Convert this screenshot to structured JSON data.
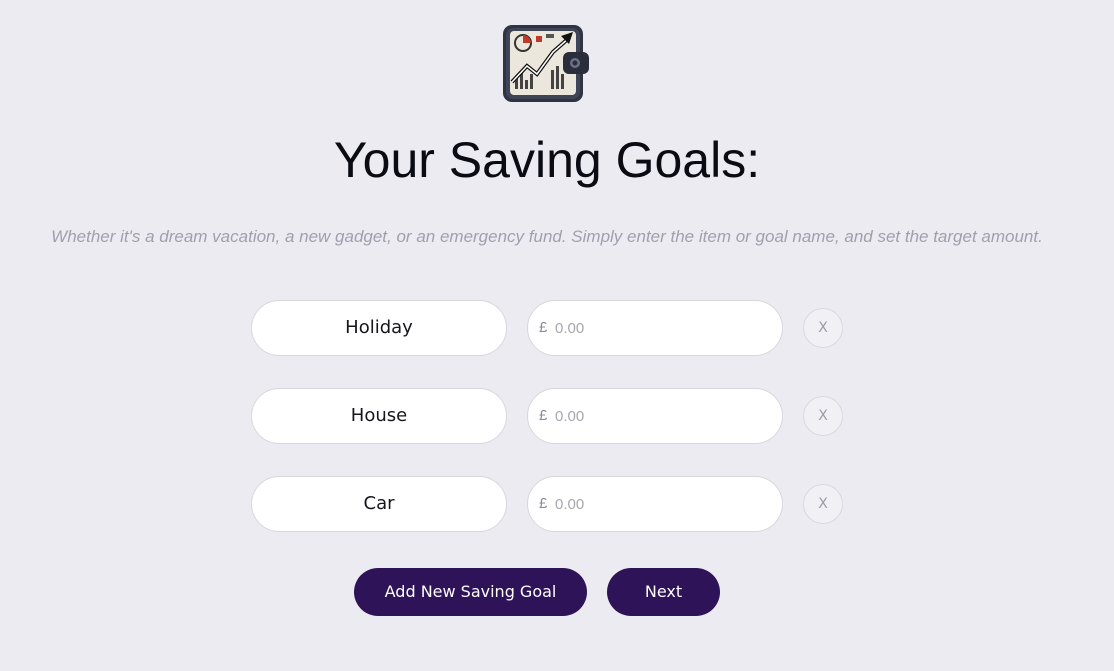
{
  "header": {
    "logo_icon": "wallet-growth-chart-icon",
    "title": "Your Saving Goals:",
    "subtitle": "Whether it's a dream vacation, a new gadget, or an emergency fund. Simply enter the item or goal name, and set the target amount."
  },
  "goals": [
    {
      "name": "Holiday",
      "currency": "£",
      "amount_placeholder": "0.00",
      "amount_value": "",
      "remove_label": "X"
    },
    {
      "name": "House",
      "currency": "£",
      "amount_placeholder": "0.00",
      "amount_value": "",
      "remove_label": "X"
    },
    {
      "name": "Car",
      "currency": "£",
      "amount_placeholder": "0.00",
      "amount_value": "",
      "remove_label": "X"
    }
  ],
  "actions": {
    "add_label": "Add New Saving Goal",
    "next_label": "Next"
  },
  "colors": {
    "background": "#edebf2",
    "primary_button": "#2e1358",
    "subtitle_text": "#a09fac"
  }
}
